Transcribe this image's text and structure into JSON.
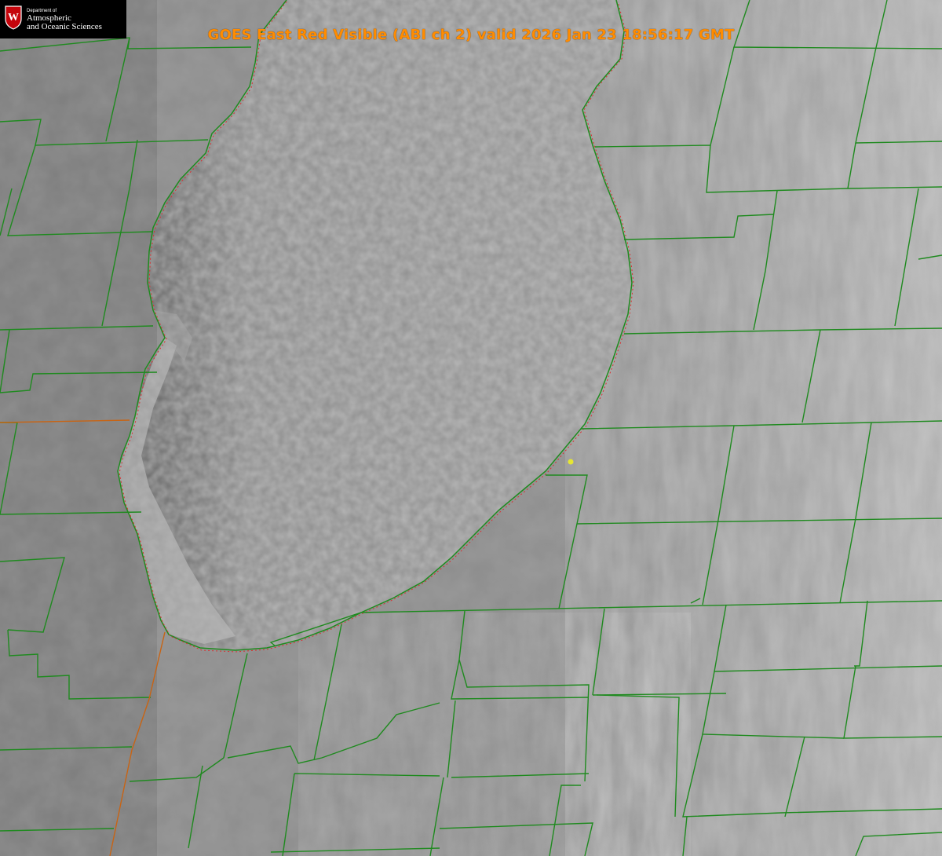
{
  "title": "GOES East Red Visible (ABI ch 2) valid 2026 Jan 23 18:56:17 GMT",
  "logo": {
    "department_label": "Department of",
    "line1": "Atmospheric",
    "line2": "and Oceanic Sciences",
    "shield_letter": "W",
    "shield_color": "#c5050c"
  },
  "colors": {
    "county_lines": "#1f8a1f",
    "state_line": "#c86414",
    "shoreline_dots": "#d93030",
    "title": "#ff8c00",
    "marker": "#e6e632"
  }
}
